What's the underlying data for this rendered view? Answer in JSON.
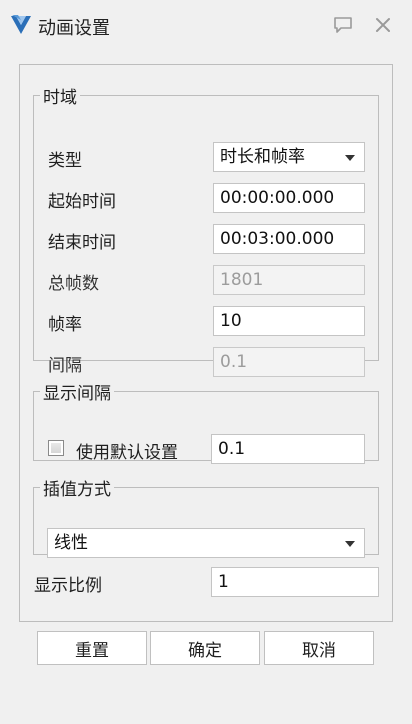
{
  "window": {
    "title": "动画设置",
    "icon": "app-logo-icon",
    "actions": [
      "feedback-icon",
      "close-icon"
    ]
  },
  "time_domain": {
    "legend": "时域",
    "type_label": "类型",
    "type_value": "时长和帧率",
    "start_label": "起始时间",
    "start_value": "00:00:00.000",
    "end_label": "结束时间",
    "end_value": "00:03:00.000",
    "total_frames_label": "总帧数",
    "total_frames_value": "1801",
    "frame_rate_label": "帧率",
    "frame_rate_value": "10",
    "interval_label": "间隔",
    "interval_value": "0.1"
  },
  "display_interval": {
    "legend": "显示间隔",
    "checkbox_label": "使用默认设置",
    "checkbox_checked": false,
    "value": "0.1"
  },
  "interpolation": {
    "legend": "插值方式",
    "value": "线性"
  },
  "display_ratio": {
    "label": "显示比例",
    "value": "1"
  },
  "buttons": {
    "reset": "重置",
    "ok": "确定",
    "cancel": "取消"
  },
  "colors": {
    "background": "#f0f0f0",
    "border": "#bdbdbd",
    "disabled_text": "#9c9c9c",
    "logo_blue": "#2b6fb8"
  }
}
